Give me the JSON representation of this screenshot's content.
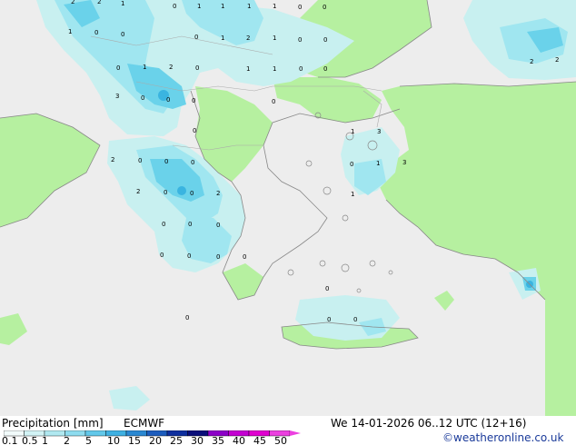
{
  "map_layer": {
    "colors": {
      "land": "#ededed",
      "sea": "#ededed",
      "green_land": "#b6f0a0",
      "precip_light": "#c8f0f0",
      "precip_mid": "#a0e6f0",
      "precip_heavy": "#6ad2ea",
      "precip_max": "#3ab4e0",
      "coastline": "#888888",
      "border": "#aaaaaa"
    },
    "point_values": [
      {
        "v": "2"
      },
      {
        "v": "2"
      },
      {
        "v": "1"
      },
      {
        "v": "0"
      },
      {
        "v": "1"
      },
      {
        "v": "1"
      },
      {
        "v": "1"
      },
      {
        "v": "1"
      },
      {
        "v": "0"
      },
      {
        "v": "0"
      },
      {
        "v": "1"
      },
      {
        "v": "0"
      },
      {
        "v": "0"
      },
      {
        "v": "1"
      },
      {
        "v": "2"
      },
      {
        "v": "1"
      },
      {
        "v": "0"
      },
      {
        "v": "0"
      },
      {
        "v": "0"
      },
      {
        "v": "1"
      },
      {
        "v": "2"
      },
      {
        "v": "0"
      },
      {
        "v": "1"
      },
      {
        "v": "1"
      },
      {
        "v": "0"
      },
      {
        "v": "0"
      },
      {
        "v": "2"
      },
      {
        "v": "2"
      },
      {
        "v": "0"
      },
      {
        "v": "3"
      },
      {
        "v": "0"
      },
      {
        "v": "0"
      },
      {
        "v": "0"
      },
      {
        "v": "0"
      },
      {
        "v": "0"
      },
      {
        "v": "1"
      },
      {
        "v": "3"
      },
      {
        "v": "2"
      },
      {
        "v": "0"
      },
      {
        "v": "0"
      },
      {
        "v": "0"
      },
      {
        "v": "0"
      },
      {
        "v": "1"
      },
      {
        "v": "3"
      },
      {
        "v": "2"
      },
      {
        "v": "0"
      },
      {
        "v": "0"
      },
      {
        "v": "2"
      },
      {
        "v": "1"
      },
      {
        "v": "0"
      },
      {
        "v": "0"
      },
      {
        "v": "0"
      },
      {
        "v": "0"
      },
      {
        "v": "0"
      },
      {
        "v": "0"
      },
      {
        "v": "0"
      },
      {
        "v": "0"
      },
      {
        "v": "0"
      },
      {
        "v": "0"
      },
      {
        "v": "0"
      }
    ]
  },
  "footer": {
    "title": "Precipitation [mm]",
    "model": "ECMWF",
    "datetime": "We 14-01-2026 06..12 UTC (12+16)",
    "copyright": "©weatheronline.co.uk"
  },
  "legend": {
    "labels": [
      "0.1",
      "0.5",
      "1",
      "2",
      "5",
      "10",
      "15",
      "20",
      "25",
      "30",
      "35",
      "40",
      "45",
      "50"
    ],
    "colors": [
      "#f2fbfb",
      "#d2f3f5",
      "#b0e8f0",
      "#8edcef",
      "#62c8ea",
      "#3eb0e2",
      "#2a88d2",
      "#1c5cbd",
      "#0e2f9e",
      "#0a0f7a",
      "#8c00c8",
      "#c400d2",
      "#e000d0",
      "#ec40e0"
    ]
  }
}
